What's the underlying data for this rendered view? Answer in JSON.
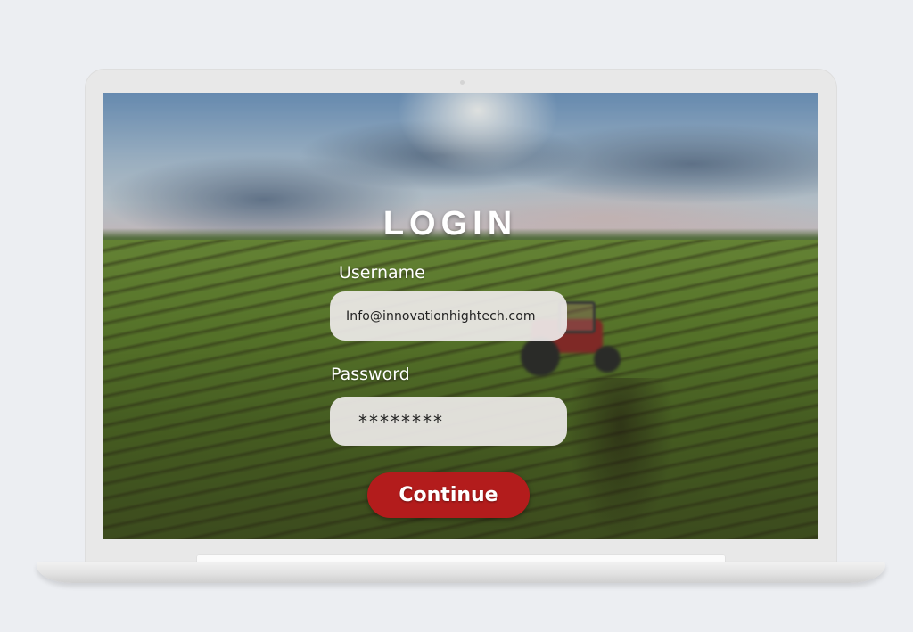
{
  "login": {
    "title": "LOGIN",
    "username_label": "Username",
    "username_value": "Info@innovationhightech.com",
    "password_label": "Password",
    "password_value": "********",
    "continue_label": "Continue"
  },
  "colors": {
    "button_accent": "#b31c1c",
    "input_background": "#eeeae9",
    "page_background": "#eceef2"
  }
}
